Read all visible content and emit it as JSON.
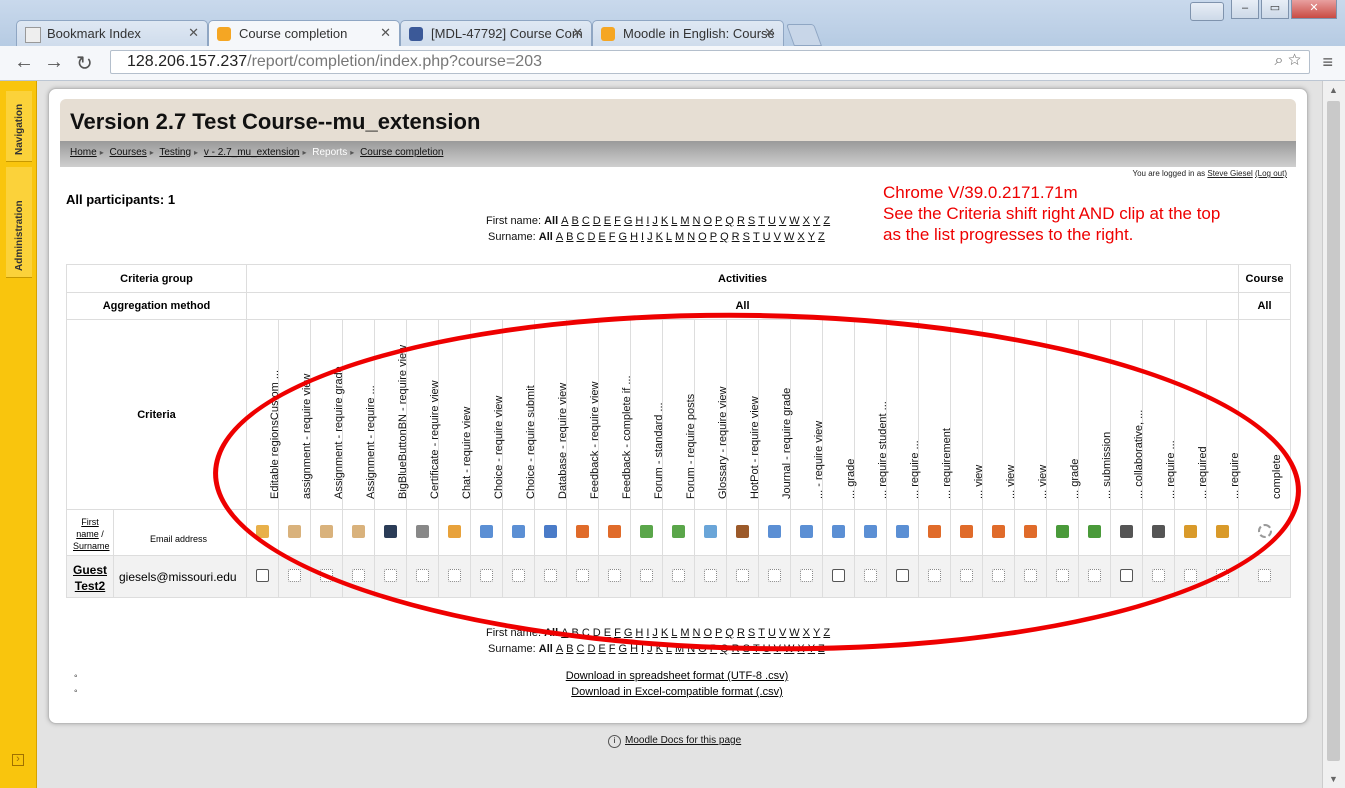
{
  "browser": {
    "tabs": [
      {
        "label": "Bookmark Index",
        "icon": "bookmark-page-icon",
        "color": "#dfe8f3"
      },
      {
        "label": "Course completion",
        "icon": "moodle-icon",
        "color": "#f5a623"
      },
      {
        "label": "[MDL-47792] Course Com",
        "icon": "jira-icon",
        "color": "#3b5998"
      },
      {
        "label": "Moodle in English: Course",
        "icon": "moodle-icon",
        "color": "#f5a623"
      }
    ],
    "url_host": "128.206.157.237",
    "url_path": "/report/completion/index.php?course=203"
  },
  "dock": {
    "navigation": "Navigation",
    "administration": "Administration"
  },
  "page": {
    "title": "Version 2.7 Test Course--mu_extension",
    "breadcrumb": [
      "Home",
      "Courses",
      "Testing",
      "v - 2.7_mu_extension",
      "Reports",
      "Course completion"
    ],
    "login_prefix": "You are logged in as",
    "login_user": "Steve Giesel",
    "login_logout": "(Log out)",
    "participants": "All participants: 1",
    "firstname_label": "First name:",
    "surname_label": "Surname:",
    "all": "All",
    "letters": [
      "A",
      "B",
      "C",
      "D",
      "E",
      "F",
      "G",
      "H",
      "I",
      "J",
      "K",
      "L",
      "M",
      "N",
      "O",
      "P",
      "Q",
      "R",
      "S",
      "T",
      "U",
      "V",
      "W",
      "X",
      "Y",
      "Z"
    ],
    "annotation": [
      "Chrome V/39.0.2171.71m",
      "See the Criteria shift right AND clip at the top",
      "as the list progresses to the right."
    ]
  },
  "table": {
    "criteria_group": "Criteria group",
    "activities": "Activities",
    "course": "Course",
    "aggregation_method": "Aggregation method",
    "agg_all": "All",
    "agg_course_all": "All",
    "criteria": "Criteria",
    "firstname_header": "First name",
    "surname_header": "Surname",
    "email_header": "Email address",
    "criteria_items": [
      {
        "label": "Editable regionsCustom ...",
        "icon_color": "#e8b04a"
      },
      {
        "label": "assignment - require view",
        "icon_color": "#d9b27c"
      },
      {
        "label": "Assignment - require grade",
        "icon_color": "#d9b27c"
      },
      {
        "label": "Assignment - require ...",
        "icon_color": "#d9b27c"
      },
      {
        "label": "BigBlueButtonBN - require view",
        "icon_color": "#2b3c57"
      },
      {
        "label": "Certificate - require view",
        "icon_color": "#888888"
      },
      {
        "label": "Chat - require view",
        "icon_color": "#e8a23b"
      },
      {
        "label": "Choice - require view",
        "icon_color": "#5b8fd4"
      },
      {
        "label": "Choice - require submit",
        "icon_color": "#5b8fd4"
      },
      {
        "label": "Database - require view",
        "icon_color": "#4a7bc8"
      },
      {
        "label": "Feedback - require view",
        "icon_color": "#e06b2a"
      },
      {
        "label": "Feedback - complete if ...",
        "icon_color": "#e06b2a"
      },
      {
        "label": "Forum - standard ...",
        "icon_color": "#5aa64a"
      },
      {
        "label": "Forum - require posts",
        "icon_color": "#5aa64a"
      },
      {
        "label": "Glossary - require view",
        "icon_color": "#6aa5d8"
      },
      {
        "label": "HotPot - require view",
        "icon_color": "#9c5a2a"
      },
      {
        "label": "Journal - require grade",
        "icon_color": "#5b8fd4"
      },
      {
        "label": "... - require view",
        "icon_color": "#5b8fd4"
      },
      {
        "label": "... grade",
        "icon_color": "#5b8fd4"
      },
      {
        "label": "... require student ...",
        "icon_color": "#5b8fd4"
      },
      {
        "label": "... require ...",
        "icon_color": "#5b8fd4"
      },
      {
        "label": "... requirement",
        "icon_color": "#e06b2a"
      },
      {
        "label": "... view",
        "icon_color": "#e06b2a"
      },
      {
        "label": "... view",
        "icon_color": "#e06b2a"
      },
      {
        "label": "... view",
        "icon_color": "#e06b2a"
      },
      {
        "label": "... grade",
        "icon_color": "#4a9a3a"
      },
      {
        "label": "... submission",
        "icon_color": "#4a9a3a"
      },
      {
        "label": "... collaborative, ...",
        "icon_color": "#555555"
      },
      {
        "label": "... require ...",
        "icon_color": "#555555"
      },
      {
        "label": "... required",
        "icon_color": "#d99a2a"
      },
      {
        "label": "... require",
        "icon_color": "#d99a2a"
      }
    ],
    "course_criterion": "complete",
    "row": {
      "first_name": "Guest",
      "surname": "Test2",
      "email": "giesels@missouri.edu"
    }
  },
  "downloads": [
    "Download in spreadsheet format (UTF-8 .csv)",
    "Download in Excel-compatible format (.csv)"
  ],
  "docs_link": "Moodle Docs for this page"
}
